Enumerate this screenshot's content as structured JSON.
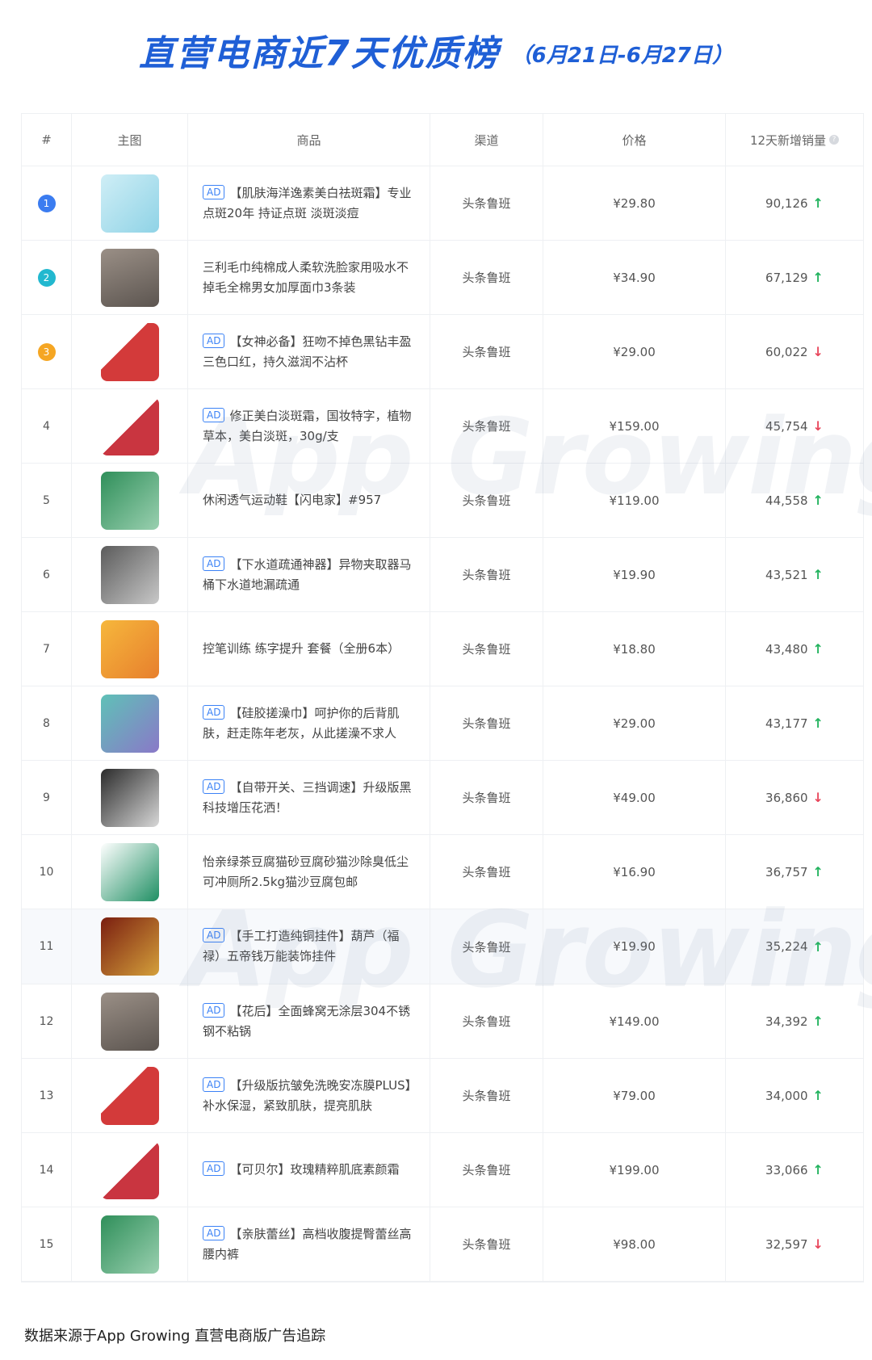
{
  "header": {
    "title": "直营电商近7天优质榜",
    "date_range": "（6月21日-6月27日）"
  },
  "table": {
    "columns": [
      "#",
      "主图",
      "商品",
      "渠道",
      "价格",
      "12天新增销量"
    ],
    "rows": [
      {
        "rank": "1",
        "ad": true,
        "product": "【肌肤海洋逸素美白祛斑霜】专业点斑20年 持证点斑 淡斑淡痘",
        "channel": "头条鲁班",
        "price": "¥29.80",
        "sales": "90,126",
        "trend": "up"
      },
      {
        "rank": "2",
        "ad": false,
        "product": "三利毛巾纯棉成人柔软洗脸家用吸水不掉毛全棉男女加厚面巾3条装",
        "channel": "头条鲁班",
        "price": "¥34.90",
        "sales": "67,129",
        "trend": "up"
      },
      {
        "rank": "3",
        "ad": true,
        "product": "【女神必备】狂吻不掉色黑钻丰盈三色口红，持久滋润不沾杯",
        "channel": "头条鲁班",
        "price": "¥29.00",
        "sales": "60,022",
        "trend": "down"
      },
      {
        "rank": "4",
        "ad": true,
        "product": "修正美白淡斑霜，国妆特字，植物草本，美白淡斑，30g/支",
        "channel": "头条鲁班",
        "price": "¥159.00",
        "sales": "45,754",
        "trend": "down"
      },
      {
        "rank": "5",
        "ad": false,
        "product": "休闲透气运动鞋【闪电家】#957",
        "channel": "头条鲁班",
        "price": "¥119.00",
        "sales": "44,558",
        "trend": "up"
      },
      {
        "rank": "6",
        "ad": true,
        "product": "【下水道疏通神器】异物夹取器马桶下水道地漏疏通",
        "channel": "头条鲁班",
        "price": "¥19.90",
        "sales": "43,521",
        "trend": "up"
      },
      {
        "rank": "7",
        "ad": false,
        "product": "控笔训练 练字提升 套餐（全册6本）",
        "channel": "头条鲁班",
        "price": "¥18.80",
        "sales": "43,480",
        "trend": "up"
      },
      {
        "rank": "8",
        "ad": true,
        "product": "【硅胶搓澡巾】呵护你的后背肌肤，赶走陈年老灰，从此搓澡不求人",
        "channel": "头条鲁班",
        "price": "¥29.00",
        "sales": "43,177",
        "trend": "up"
      },
      {
        "rank": "9",
        "ad": true,
        "product": "【自带开关、三挡调速】升级版黑科技增压花洒！",
        "channel": "头条鲁班",
        "price": "¥49.00",
        "sales": "36,860",
        "trend": "down"
      },
      {
        "rank": "10",
        "ad": false,
        "product": "怡亲绿茶豆腐猫砂豆腐砂猫沙除臭低尘可冲厕所2.5kg猫沙豆腐包邮",
        "channel": "头条鲁班",
        "price": "¥16.90",
        "sales": "36,757",
        "trend": "up"
      },
      {
        "rank": "11",
        "ad": true,
        "product": "【手工打造纯铜挂件】葫芦（福禄）五帝钱万能装饰挂件",
        "channel": "头条鲁班",
        "price": "¥19.90",
        "sales": "35,224",
        "trend": "up"
      },
      {
        "rank": "12",
        "ad": true,
        "product": "【花后】全面蜂窝无涂层304不锈钢不粘锅",
        "channel": "头条鲁班",
        "price": "¥149.00",
        "sales": "34,392",
        "trend": "up"
      },
      {
        "rank": "13",
        "ad": true,
        "product": "【升级版抗皱免洗晚安冻膜PLUS】补水保湿，紧致肌肤，提亮肌肤",
        "channel": "头条鲁班",
        "price": "¥79.00",
        "sales": "34,000",
        "trend": "up"
      },
      {
        "rank": "14",
        "ad": true,
        "product": "【可贝尔】玫瑰精粹肌底素颜霜",
        "channel": "头条鲁班",
        "price": "¥199.00",
        "sales": "33,066",
        "trend": "up"
      },
      {
        "rank": "15",
        "ad": true,
        "product": "【亲肤蕾丝】高档收腹提臀蕾丝高腰内裤",
        "channel": "头条鲁班",
        "price": "¥98.00",
        "sales": "32,597",
        "trend": "down"
      }
    ]
  },
  "labels": {
    "ad": "AD",
    "arrow_up": "↑",
    "arrow_down": "↓",
    "info": "?"
  },
  "watermark": "App Growing",
  "footer": "数据来源于App Growing 直营电商版广告追踪",
  "colors": {
    "title": "#1f5fd6",
    "rank1": "#3b7cf0",
    "rank2": "#22b8cf",
    "rank3": "#f5a623",
    "up": "#22b35e",
    "down": "#e8475c"
  }
}
